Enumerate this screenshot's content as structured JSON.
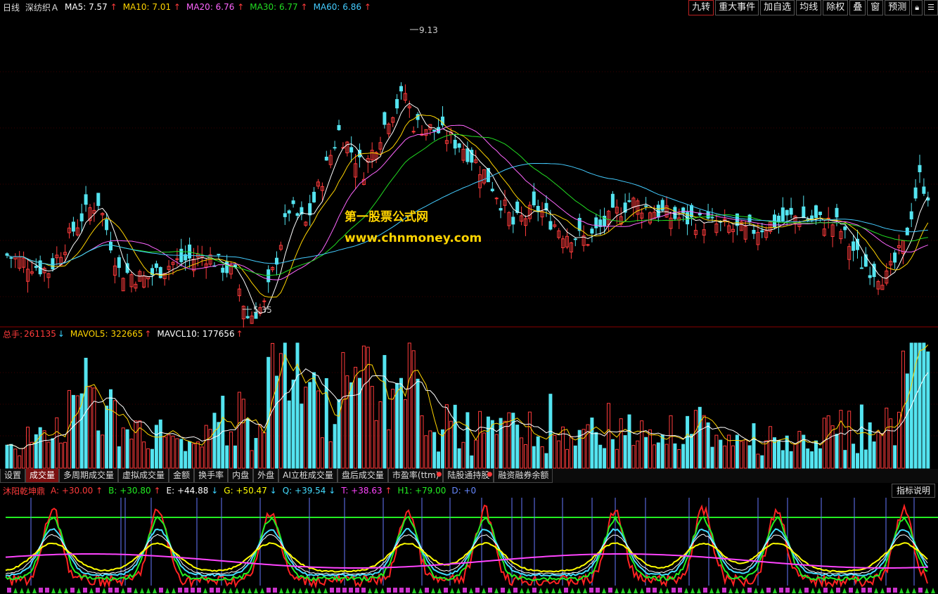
{
  "top": {
    "period": "日线",
    "stock": "深纺织Ａ",
    "ma": [
      {
        "label": "MA5:",
        "value": "7.57",
        "color": "#ffffff",
        "dir": "up"
      },
      {
        "label": "MA10:",
        "value": "7.01",
        "color": "#ffd400",
        "dir": "up"
      },
      {
        "label": "MA20:",
        "value": "6.76",
        "color": "#ff66ff",
        "dir": "up"
      },
      {
        "label": "MA30:",
        "value": "6.77",
        "color": "#22dd22",
        "dir": "up"
      },
      {
        "label": "MA60:",
        "value": "6.86",
        "color": "#44ccff",
        "dir": "up"
      }
    ],
    "buttons": [
      "九转",
      "重大事件",
      "加自选",
      "均线",
      "除权",
      "叠",
      "窗",
      "预测"
    ]
  },
  "price_chart": {
    "high_label": "9.13",
    "low_label": "5.35",
    "watermark_1": "第一股票公式网",
    "watermark_2": "www.chnmoney.com"
  },
  "volume": {
    "total_label": "总手:",
    "total_value": "261135",
    "mavol5_label": "MAVOL5:",
    "mavol5_value": "322665",
    "mavcl10_label": "MAVCL10:",
    "mavcl10_value": "177656"
  },
  "tabs": [
    "设置",
    "成交量",
    "多周期成交量",
    "虚拟成交量",
    "金额",
    "换手率",
    "内盘",
    "外盘",
    "AI立桩成交量",
    "盘后成交量",
    "市盈率(ttm)",
    "陆股通持股",
    "融资融券余额"
  ],
  "indicator": {
    "name": "沐阳乾坤鼎",
    "values": [
      {
        "label": "A:",
        "value": "+30.00",
        "color": "#ff3b3b",
        "dir": "up"
      },
      {
        "label": "B:",
        "value": "+30.80",
        "color": "#22ee22",
        "dir": "up"
      },
      {
        "label": "E:",
        "value": "+44.88",
        "color": "#ffffff",
        "dir": "down"
      },
      {
        "label": "G:",
        "value": "+50.47",
        "color": "#ffff00",
        "dir": "down"
      },
      {
        "label": "Q:",
        "value": "+39.54",
        "color": "#44ddff",
        "dir": "down"
      },
      {
        "label": "T:",
        "value": "+38.63",
        "color": "#ff44ff",
        "dir": "up"
      },
      {
        "label": "H1:",
        "value": "+79.00",
        "color": "#22ee22",
        "dir": ""
      },
      {
        "label": "D:",
        "value": "+0",
        "color": "#6688ff",
        "dir": ""
      }
    ],
    "help_button": "指标说明"
  },
  "colors": {
    "up": "#ff3b3b",
    "down": "#54e4f0",
    "bg": "#000000"
  }
}
